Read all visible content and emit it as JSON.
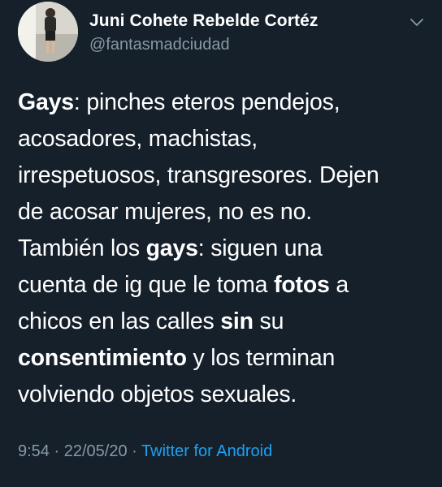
{
  "tweet": {
    "display_name": "Juni Cohete Rebelde Cortéz",
    "handle": "@fantasmadciudad",
    "lines": [
      [
        {
          "t": "Gays",
          "b": true
        },
        {
          "t": ": pinches eteros pendejos,",
          "b": false
        }
      ],
      [
        {
          "t": "acosadores, machistas,",
          "b": false
        }
      ],
      [
        {
          "t": "irrespetuosos, transgresores. Dejen",
          "b": false
        }
      ],
      [
        {
          "t": "de acosar mujeres, no es no.",
          "b": false
        }
      ],
      [
        {
          "t": "También los ",
          "b": false
        },
        {
          "t": "gays",
          "b": true
        },
        {
          "t": ": siguen una",
          "b": false
        }
      ],
      [
        {
          "t": "cuenta de ig que le toma ",
          "b": false
        },
        {
          "t": "fotos",
          "b": true
        },
        {
          "t": " a",
          "b": false
        }
      ],
      [
        {
          "t": "chicos en las calles ",
          "b": false
        },
        {
          "t": "sin",
          "b": true
        },
        {
          "t": " su",
          "b": false
        }
      ],
      [
        {
          "t": "consentimiento",
          "b": true
        },
        {
          "t": " y los terminan",
          "b": false
        }
      ],
      [
        {
          "t": "volviendo objetos sexuales.",
          "b": false
        }
      ]
    ],
    "time": "9:54",
    "date": "22/05/20",
    "separator": "·",
    "source": "Twitter for Android"
  },
  "colors": {
    "background": "#15202b",
    "text": "#ffffff",
    "muted": "#8899a6",
    "link": "#1da1f2"
  },
  "icons": {
    "menu": "chevron-down-icon"
  }
}
